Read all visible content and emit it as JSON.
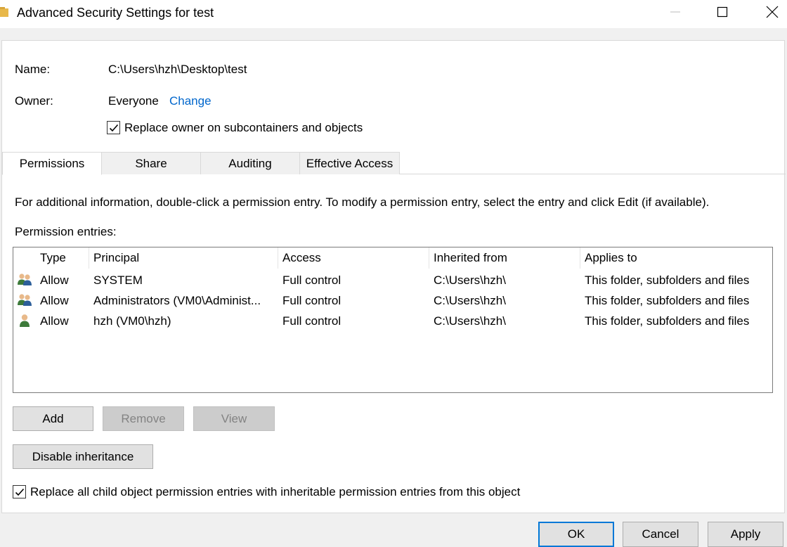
{
  "window": {
    "title": "Advanced Security Settings for test",
    "minimize_icon": "minimize-icon",
    "maximize_icon": "maximize-icon",
    "close_icon": "close-icon"
  },
  "name_label": "Name:",
  "name_value": "C:\\Users\\hzh\\Desktop\\test",
  "owner_label": "Owner:",
  "owner_value": "Everyone",
  "owner_change_link": "Change",
  "replace_owner_label": "Replace owner on subcontainers and objects",
  "replace_owner_checked": true,
  "tabs": [
    {
      "label": "Permissions",
      "active": true
    },
    {
      "label": "Share",
      "active": false
    },
    {
      "label": "Auditing",
      "active": false
    },
    {
      "label": "Effective Access",
      "active": false
    }
  ],
  "info_text": "For additional information, double-click a permission entry. To modify a permission entry, select the entry and click Edit (if available).",
  "entries_label": "Permission entries:",
  "columns": [
    "Type",
    "Principal",
    "Access",
    "Inherited from",
    "Applies to"
  ],
  "rows": [
    {
      "icon": "group-users-icon",
      "type": "Allow",
      "principal": "SYSTEM",
      "access": "Full control",
      "inherited": "C:\\Users\\hzh\\",
      "applies": "This folder, subfolders and files"
    },
    {
      "icon": "group-users-icon",
      "type": "Allow",
      "principal": "Administrators (VM0\\Administ...",
      "access": "Full control",
      "inherited": "C:\\Users\\hzh\\",
      "applies": "This folder, subfolders and files"
    },
    {
      "icon": "single-user-icon",
      "type": "Allow",
      "principal": "hzh (VM0\\hzh)",
      "access": "Full control",
      "inherited": "C:\\Users\\hzh\\",
      "applies": "This folder, subfolders and files"
    }
  ],
  "buttons": {
    "add": "Add",
    "remove": "Remove",
    "view": "View",
    "disable_inheritance": "Disable inheritance",
    "ok": "OK",
    "cancel": "Cancel",
    "apply": "Apply"
  },
  "replace_child_label": "Replace all child object permission entries with inheritable permission entries from this object",
  "replace_child_checked": true,
  "colors": {
    "accent": "#0078d7",
    "link": "#0066cc",
    "disabled_button": "#cccccc"
  }
}
